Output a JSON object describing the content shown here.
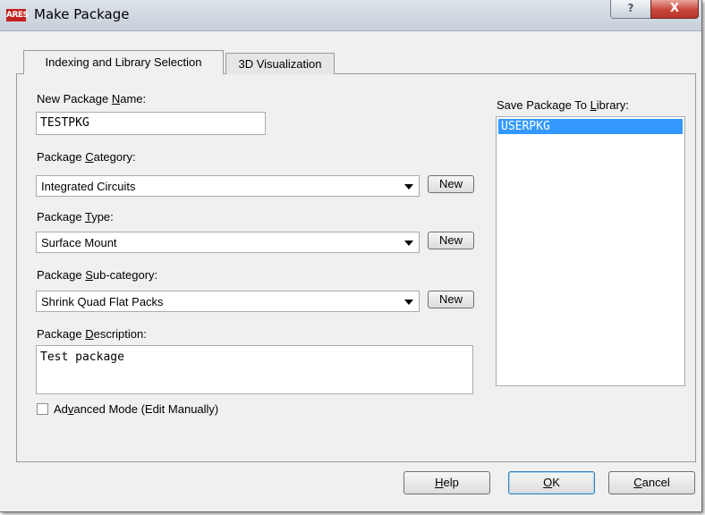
{
  "window": {
    "title": "Make Package",
    "app_icon": "ARES"
  },
  "titlebar": {
    "help_label": "?",
    "close_label": "X"
  },
  "tabs": [
    {
      "label": "Indexing and Library Selection",
      "selected": true
    },
    {
      "label": "3D Visualization",
      "selected": false
    }
  ],
  "name": {
    "label_pre": "New Package ",
    "label_key": "N",
    "label_post": "ame:",
    "value": "TESTPKG"
  },
  "category": {
    "label_pre": "Package ",
    "label_key": "C",
    "label_post": "ategory:",
    "value": "Integrated Circuits",
    "new_label": "New"
  },
  "type": {
    "label_pre": "Package ",
    "label_key": "T",
    "label_post": "ype:",
    "value": "Surface Mount",
    "new_label": "New"
  },
  "subcategory": {
    "label_pre": "Package ",
    "label_key": "S",
    "label_post": "ub-category:",
    "value": "Shrink Quad Flat Packs",
    "new_label": "New"
  },
  "description": {
    "label_pre": "Package ",
    "label_key": "D",
    "label_post": "escription:",
    "value": "Test package"
  },
  "advanced": {
    "label_pre": "Ad",
    "label_key": "v",
    "label_post": "anced Mode (Edit Manually)",
    "checked": false
  },
  "library": {
    "label_pre": "Save Package To ",
    "label_key": "L",
    "label_post": "ibrary:",
    "items": [
      "USERPKG"
    ],
    "selected": "USERPKG"
  },
  "buttons": {
    "help": {
      "key": "H",
      "rest": "elp"
    },
    "ok": {
      "key": "O",
      "rest": "K"
    },
    "cancel": {
      "key": "C",
      "rest": "ancel"
    }
  },
  "colors": {
    "selection": "#3399ff",
    "close_button": "#c9463a"
  }
}
